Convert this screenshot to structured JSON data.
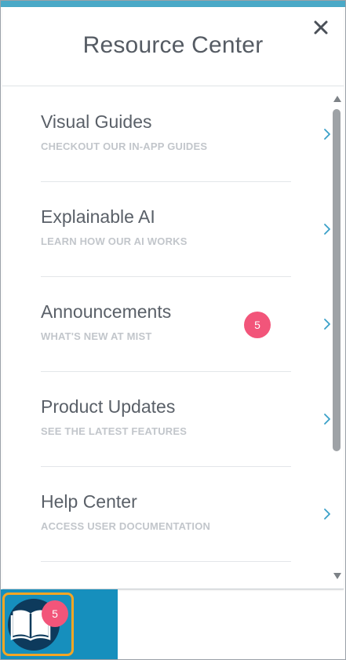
{
  "panel": {
    "title": "Resource Center",
    "close_icon": "close-icon"
  },
  "items": [
    {
      "title": "Visual Guides",
      "subtitle": "CHECKOUT OUR IN-APP GUIDES",
      "badge": null,
      "icon": "chevron-right-icon"
    },
    {
      "title": "Explainable AI",
      "subtitle": "LEARN HOW OUR AI WORKS",
      "badge": null,
      "icon": "chevron-right-icon"
    },
    {
      "title": "Announcements",
      "subtitle": "WHAT'S NEW AT MIST",
      "badge": "5",
      "icon": "chevron-right-icon"
    },
    {
      "title": "Product Updates",
      "subtitle": "SEE THE LATEST FEATURES",
      "badge": null,
      "icon": "chevron-right-icon"
    },
    {
      "title": "Help Center",
      "subtitle": "ACCESS USER DOCUMENTATION",
      "badge": null,
      "icon": "chevron-right-icon"
    }
  ],
  "launcher": {
    "icon": "book-icon",
    "badge": "5"
  },
  "colors": {
    "accent": "#4aa9c7",
    "badge": "#f2557a",
    "launcher_bg": "#168fbd",
    "launcher_ring": "#f5a623",
    "launcher_circle": "#0d3a5c"
  }
}
